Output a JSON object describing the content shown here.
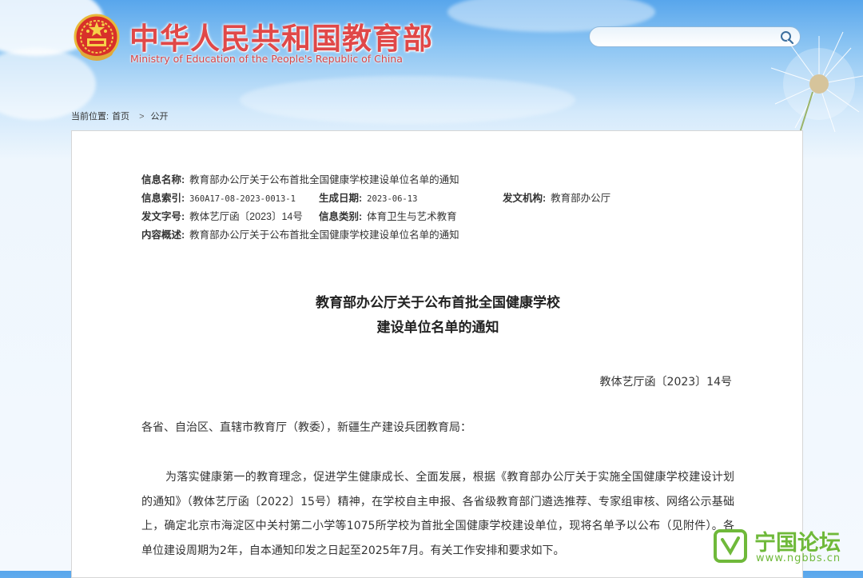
{
  "header": {
    "title": "中华人民共和国教育部",
    "subtitle": "Ministry of Education of the People's Republic of China",
    "search_placeholder": ""
  },
  "breadcrumb": {
    "prefix": "当前位置:",
    "home": "首页",
    "separator": ">",
    "current": "公开"
  },
  "info": {
    "name_label": "信息名称:",
    "name_value": "教育部办公厅关于公布首批全国健康学校建设单位名单的通知",
    "index_label": "信息索引:",
    "index_value": "360A17-08-2023-0013-1",
    "date_label": "生成日期:",
    "date_value": "2023-06-13",
    "issuer_label": "发文机构:",
    "issuer_value": "教育部办公厅",
    "docno_label": "发文字号:",
    "docno_value": "教体艺厅函〔2023〕14号",
    "category_label": "信息类别:",
    "category_value": "体育卫生与艺术教育",
    "summary_label": "内容概述:",
    "summary_value": "教育部办公厅关于公布首批全国健康学校建设单位名单的通知"
  },
  "document": {
    "title_line1": "教育部办公厅关于公布首批全国健康学校",
    "title_line2": "建设单位名单的通知",
    "number": "教体艺厅函〔2023〕14号",
    "salutation": "各省、自治区、直辖市教育厅（教委），新疆生产建设兵团教育局：",
    "paragraph": "为落实健康第一的教育理念，促进学生健康成长、全面发展，根据《教育部办公厅关于实施全国健康学校建设计划的通知》（教体艺厅函〔2022〕15号）精神，在学校自主申报、各省级教育部门遴选推荐、专家组审核、网络公示基础上，确定北京市海淀区中关村第二小学等1075所学校为首批全国健康学校建设单位，现将名单予以公布（见附件）。各单位建设周期为2年，自本通知印发之日起至2025年7月。有关工作安排和要求如下。"
  },
  "watermark": {
    "name": "宁国论坛",
    "url": "www.ngbbs.cn",
    "color": "#6fb93a"
  },
  "colors": {
    "title_red": "#e04848",
    "sky_blue": "#58a6ec"
  }
}
